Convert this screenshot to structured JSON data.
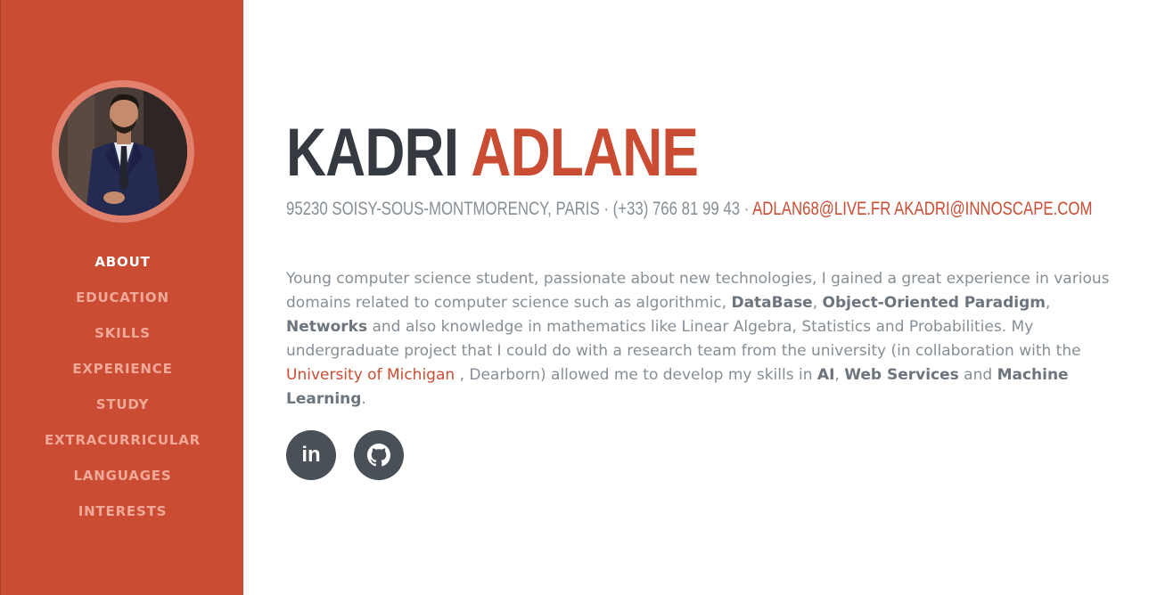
{
  "profile": {
    "first_name": "Kadri",
    "last_name": "Adlane",
    "address": "95230 Soisy-sous-Montmorency, Paris",
    "separator": "·",
    "phone": "(+33) 766 81 99 43",
    "emails": "adlan68@live.fr akadri@innoscape.com"
  },
  "sidebar": {
    "nav": [
      {
        "label": "ABOUT"
      },
      {
        "label": "EDUCATION"
      },
      {
        "label": "SKILLS"
      },
      {
        "label": "EXPERIENCE"
      },
      {
        "label": "STUDY"
      },
      {
        "label": "EXTRACURRICULAR"
      },
      {
        "label": "LANGUAGES"
      },
      {
        "label": "INTERESTS"
      }
    ]
  },
  "bio": {
    "t1": "Young computer science student, passionate about new technologies, I gained a great experience in various domains related to computer science such as algorithmic, ",
    "b1": "DataBase",
    "t2": ", ",
    "b2": "Object-Oriented Paradigm",
    "t3": ", ",
    "b3": "Networks",
    "t4": " and also knowledge in mathematics like Linear Algebra, Statistics and Probabilities. My undergraduate project that I could do with a research team from the university (in collaboration with the ",
    "link": "University of Michigan",
    "t5": " , Dearborn) allowed me to develop my skills in ",
    "b4": "AI",
    "t6": ", ",
    "b5": "Web Services",
    "t7": " and ",
    "b6": "Machine Learning",
    "t8": "."
  },
  "social": {
    "linkedin_glyph": "in"
  },
  "colors": {
    "accent": "#c94c33",
    "dark": "#343a40",
    "muted": "#868e96",
    "social_bg": "#495057"
  },
  "icons": [
    "linkedin-icon",
    "github-icon"
  ]
}
